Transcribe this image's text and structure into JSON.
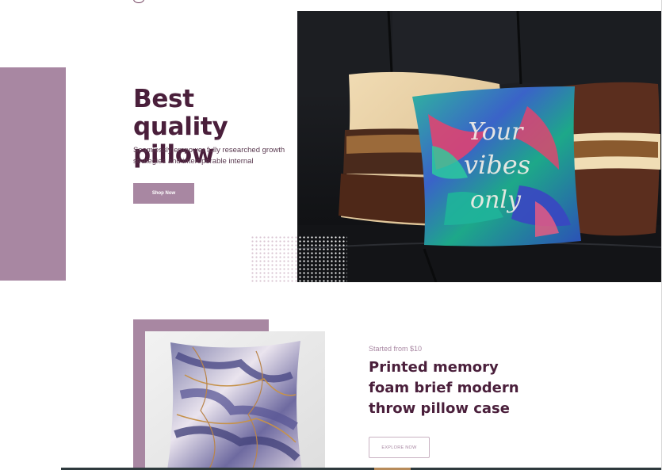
{
  "hero": {
    "title": "Best quality pillow",
    "description": "Seamlessly empower fully researched growth strategies and interoperable internal",
    "cta_label": "Shop Now"
  },
  "product": {
    "price_label": "Started from $10",
    "title": "Printed memory foam brief modern throw pillow case",
    "cta_label": "EXPLORE NOW"
  },
  "colors": {
    "accent": "#a887a2",
    "heading": "#4a1f3b",
    "body_text": "#5a3a50"
  },
  "icons": {
    "logo": "logo-icon"
  }
}
